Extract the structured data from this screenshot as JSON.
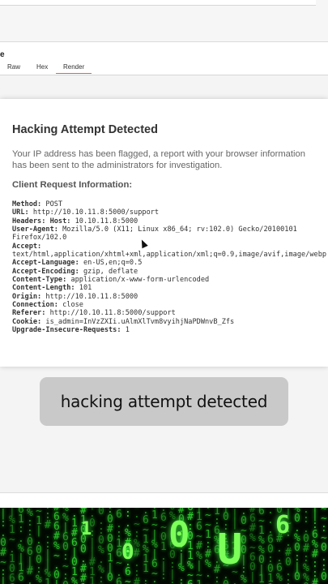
{
  "panel": {
    "title": "e",
    "tabs": [
      {
        "label": "Raw"
      },
      {
        "label": "Hex"
      },
      {
        "label": "Render",
        "active": true
      }
    ]
  },
  "page": {
    "heading": "Hacking Attempt Detected",
    "description": "Your IP address has been flagged, a report with your browser information has been sent to the administrators for investigation.",
    "subheading": "Client Request Information:",
    "request": [
      {
        "key": "Method:",
        "value": " POST"
      },
      {
        "key": "URL:",
        "value": " http://10.10.11.8:5000/support"
      },
      {
        "key": "Headers: Host:",
        "value": " 10.10.11.8:5000"
      },
      {
        "key": "User-Agent:",
        "value": " Mozilla/5.0 (X11; Linux x86_64; rv:102.0) Gecko/20100101"
      },
      {
        "key": "",
        "value": "Firefox/102.0"
      },
      {
        "key": "Accept:",
        "value": ""
      },
      {
        "key": "",
        "value": "text/html,application/xhtml+xml,application/xml;q=0.9,image/avif,image/webp"
      },
      {
        "key": "Accept-Language:",
        "value": " en-US,en;q=0.5"
      },
      {
        "key": "Accept-Encoding:",
        "value": " gzip, deflate"
      },
      {
        "key": "Content-Type:",
        "value": " application/x-www-form-urlencoded"
      },
      {
        "key": "Content-Length:",
        "value": " 101"
      },
      {
        "key": "Origin:",
        "value": " http://10.10.11.8:5000"
      },
      {
        "key": "Connection:",
        "value": " close"
      },
      {
        "key": "Referer:",
        "value": " http://10.10.11.8:5000/support"
      },
      {
        "key": "Cookie:",
        "value": " is_admin=InVzZXIi.uAlmXlTvm8vyihjNaPDWnvB_Zfs"
      },
      {
        "key": "Upgrade-Insecure-Requests:",
        "value": " 1"
      }
    ]
  },
  "caption": "hacking attempt detected"
}
